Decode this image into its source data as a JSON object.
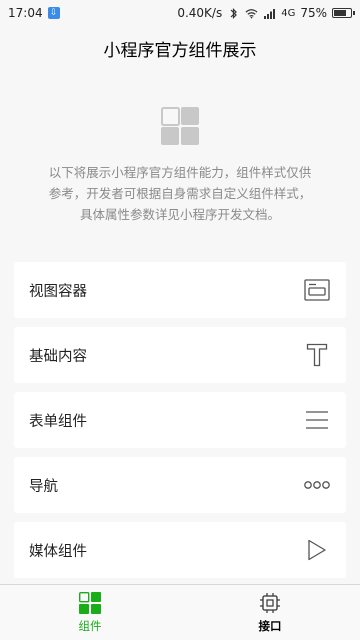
{
  "status_bar": {
    "time": "17:04",
    "network_speed": "0.40K/s",
    "network_type": "4G",
    "battery": "75%",
    "battery_level": 0.75
  },
  "navbar": {
    "title": "小程序官方组件展示"
  },
  "intro": {
    "line1": "以下将展示小程序官方组件能力，组件样式仅供",
    "line2": "参考，开发者可根据自身需求自定义组件样式，",
    "line3": "具体属性参数详见小程序开发文档。"
  },
  "menu": {
    "items": [
      {
        "label": "视图容器",
        "icon": "view-container-icon"
      },
      {
        "label": "基础内容",
        "icon": "text-t-icon"
      },
      {
        "label": "表单组件",
        "icon": "form-lines-icon"
      },
      {
        "label": "导航",
        "icon": "more-dots-icon"
      },
      {
        "label": "媒体组件",
        "icon": "play-icon"
      }
    ]
  },
  "tabbar": {
    "tabs": [
      {
        "label": "组件",
        "icon": "component-grid-icon",
        "active": true
      },
      {
        "label": "接口",
        "icon": "chip-icon",
        "active": false
      }
    ]
  },
  "colors": {
    "accent": "#1aad19",
    "background": "#f7f7f7",
    "icon_gray": "#c8c8c8"
  }
}
